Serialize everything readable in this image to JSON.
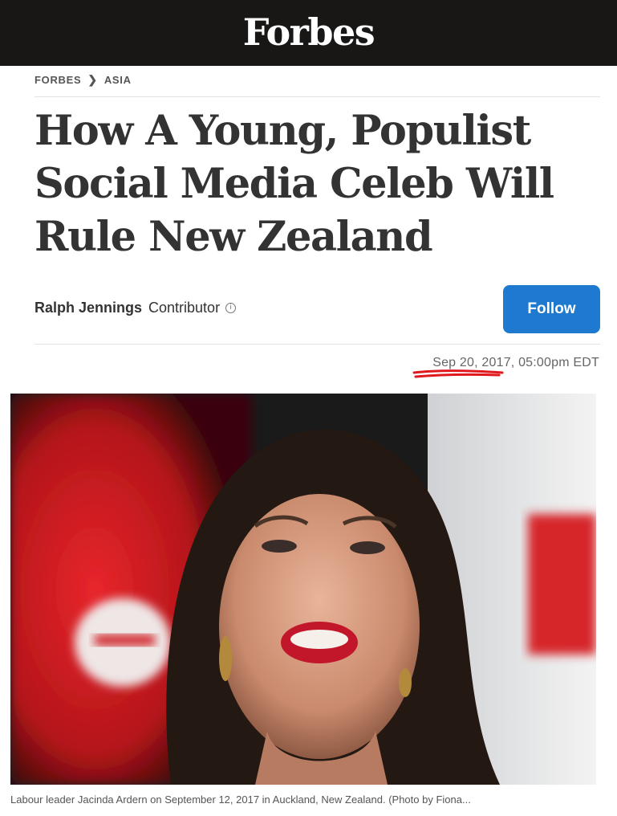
{
  "header": {
    "logo": "Forbes"
  },
  "breadcrumb": {
    "section": "FORBES",
    "subsection": "ASIA"
  },
  "article": {
    "headline_lines": [
      "How A Young, Populist",
      "Social Media Celeb Will",
      "Rule New Zealand"
    ],
    "author_name": "Ralph Jennings",
    "author_role": "Contributor",
    "follow_label": "Follow",
    "date": "Sep 20, 2017, 05:00pm EDT",
    "caption": "Labour leader Jacinda Ardern on September 12, 2017 in Auckland, New Zealand. (Photo by Fiona..."
  },
  "colors": {
    "topbar": "#181716",
    "follow_button": "#1f7acf",
    "annotation_underline": "#e0191e"
  },
  "icons": {
    "breadcrumb_separator": "chevron-right-icon",
    "author_info": "info-icon"
  }
}
